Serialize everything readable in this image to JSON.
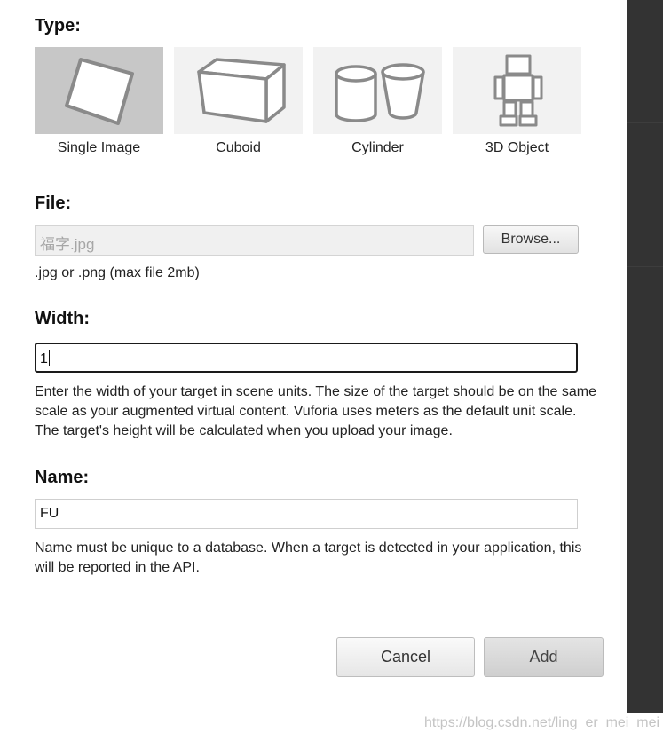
{
  "type_section": {
    "label": "Type:",
    "options": [
      {
        "label": "Single Image",
        "icon": "single-image-icon",
        "selected": true
      },
      {
        "label": "Cuboid",
        "icon": "cuboid-icon",
        "selected": false
      },
      {
        "label": "Cylinder",
        "icon": "cylinder-icon",
        "selected": false
      },
      {
        "label": "3D Object",
        "icon": "3d-object-icon",
        "selected": false
      }
    ]
  },
  "file_section": {
    "label": "File:",
    "value": "福字.jpg",
    "browse_label": "Browse...",
    "hint": ".jpg or .png (max file 2mb)"
  },
  "width_section": {
    "label": "Width:",
    "value": "1",
    "help": "Enter the width of your target in scene units. The size of the target should be on the same scale as your augmented virtual content. Vuforia uses meters as the default unit scale. The target's height will be calculated when you upload your image."
  },
  "name_section": {
    "label": "Name:",
    "value": "FU",
    "help": "Name must be unique to a database. When a target is detected in your application, this will be reported in the API."
  },
  "actions": {
    "cancel_label": "Cancel",
    "add_label": "Add"
  },
  "watermark": "https://blog.csdn.net/ling_er_mei_mei",
  "colors": {
    "selected_tile": "#c7c7c7",
    "tile": "#f2f2f2",
    "side_panel": "#333333"
  }
}
